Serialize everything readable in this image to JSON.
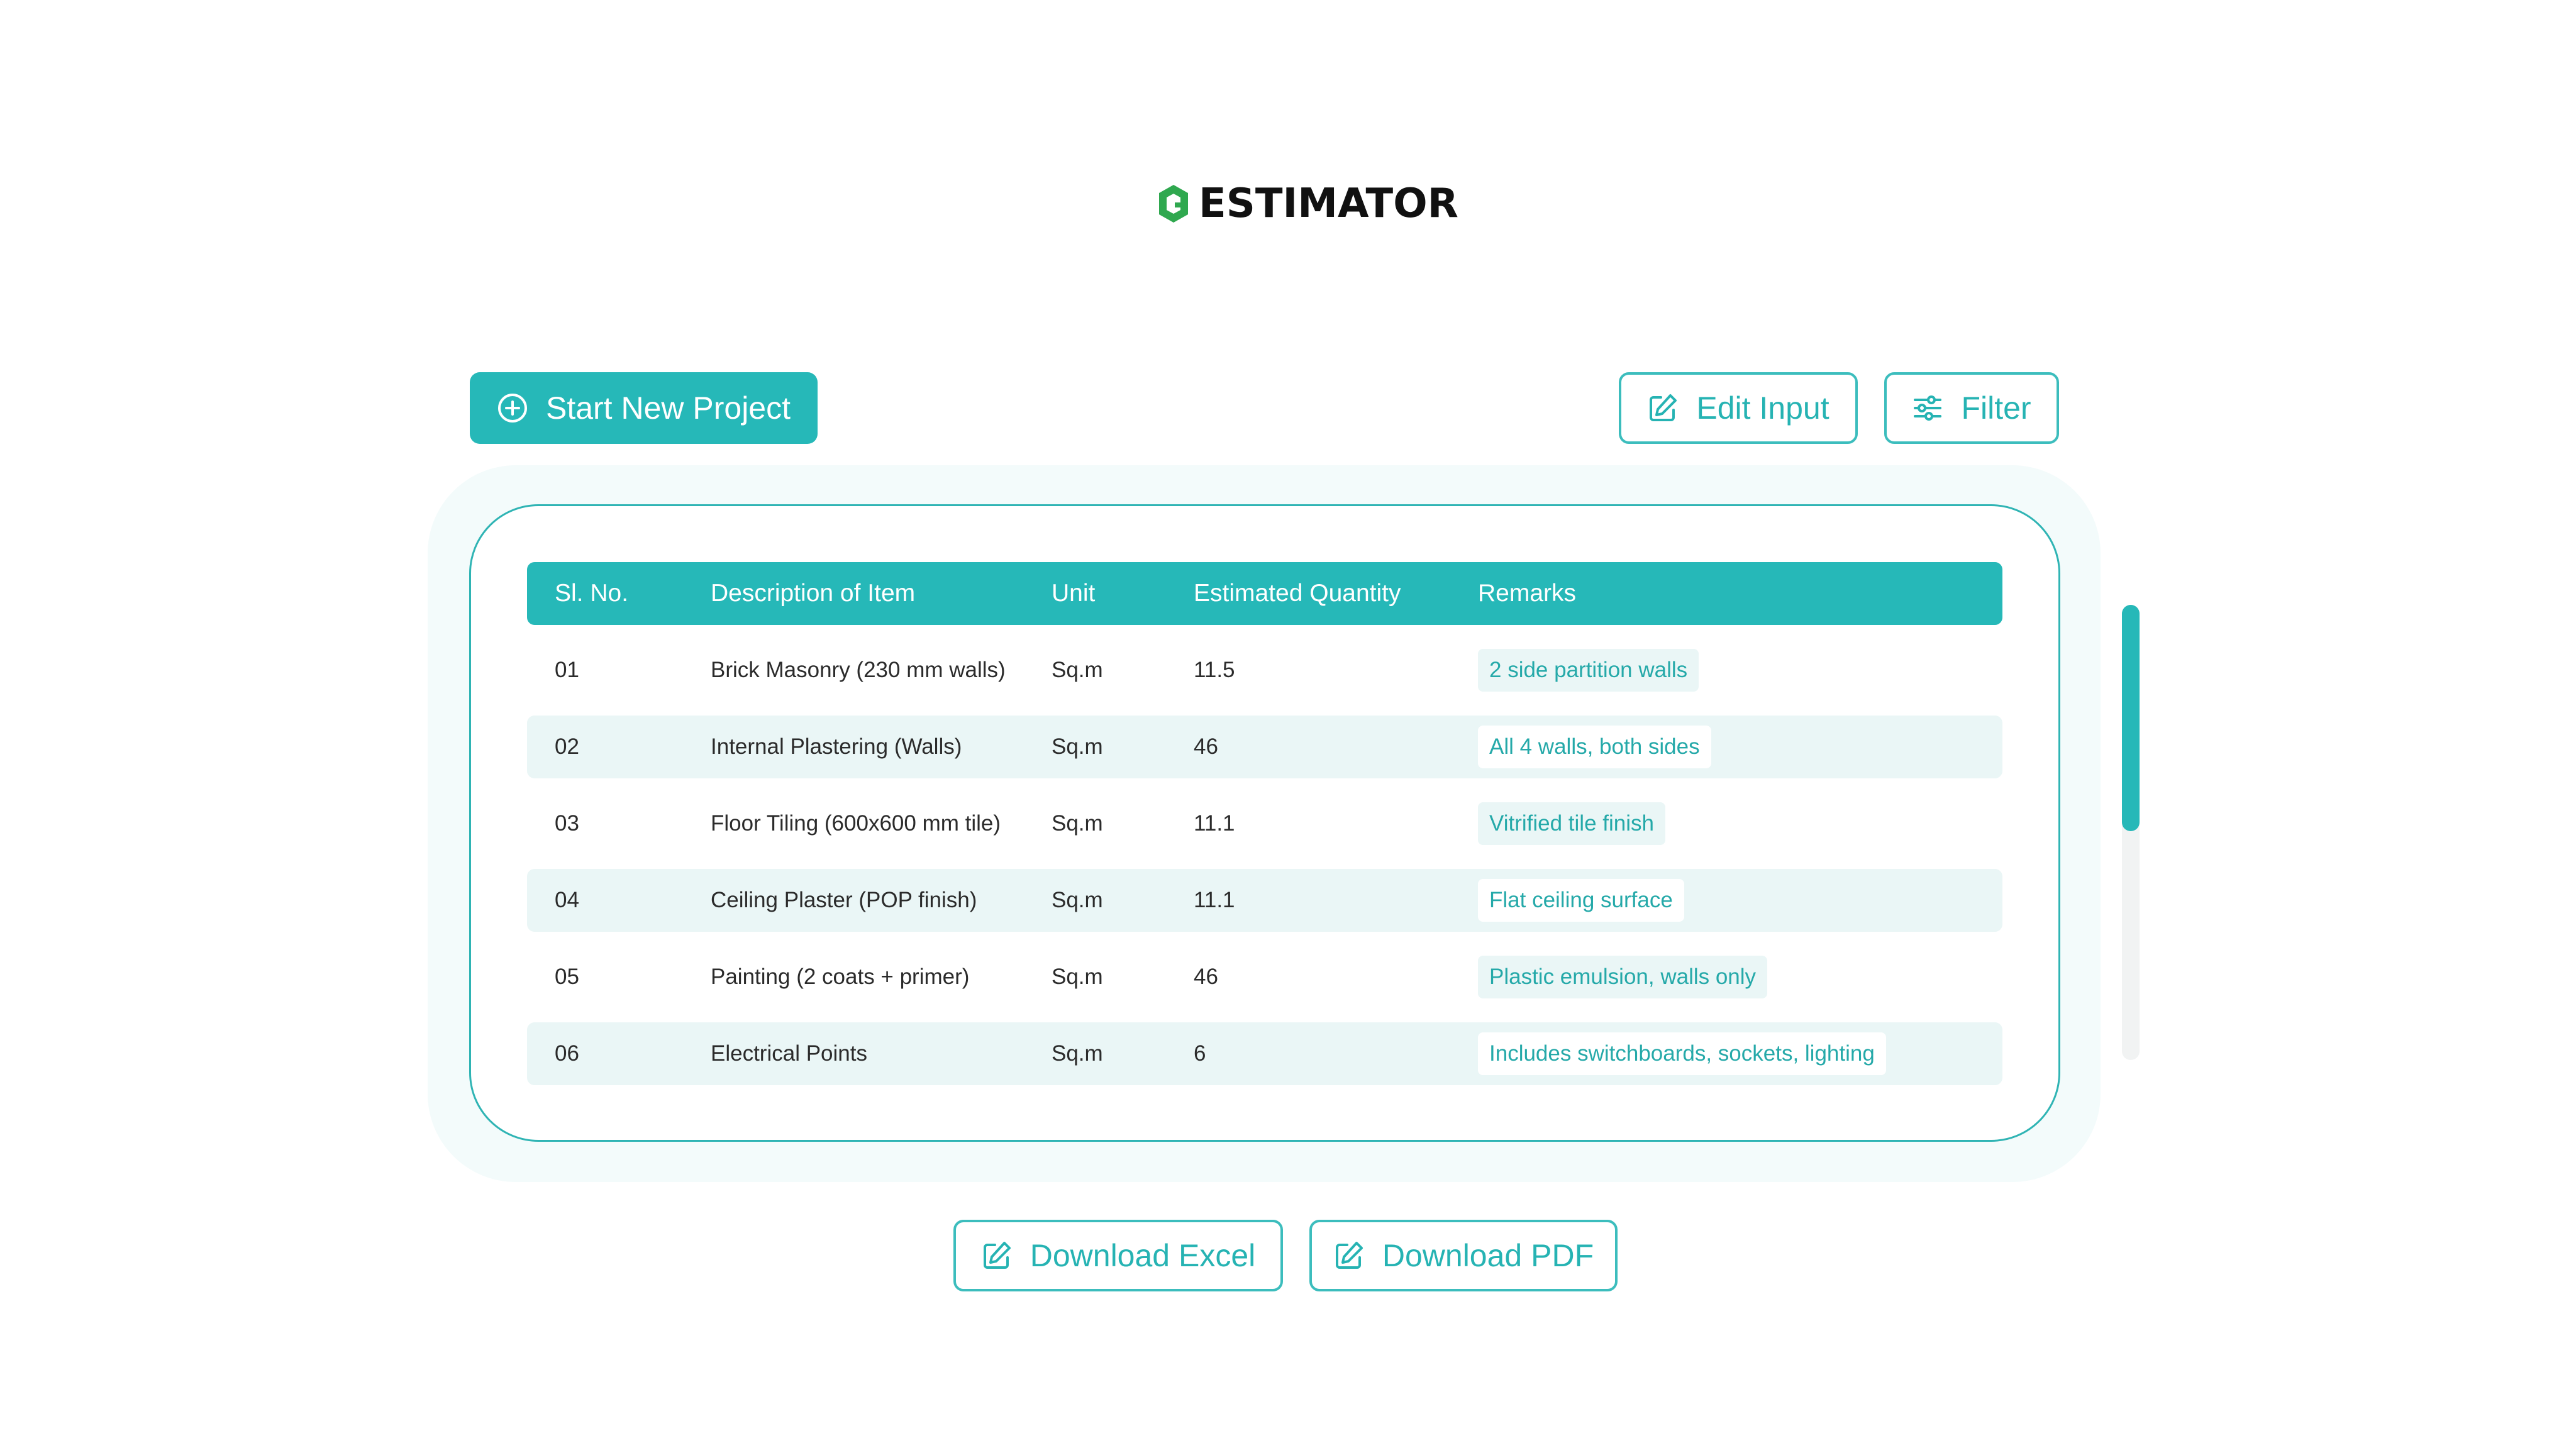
{
  "brand": {
    "name": "ESTIMATOR",
    "accent_color": "#2fa84f",
    "primary_color": "#26b8b8"
  },
  "toolbar": {
    "start_new_project_label": "Start New Project",
    "edit_input_label": "Edit Input",
    "filter_label": "Filter"
  },
  "table": {
    "columns": {
      "no": "Sl. No.",
      "description": "Description of Item",
      "unit": "Unit",
      "quantity": "Estimated Quantity",
      "remarks": "Remarks"
    },
    "rows": [
      {
        "no": "01",
        "description": "Brick Masonry (230 mm walls)",
        "unit": "Sq.m",
        "quantity": "11.5",
        "remarks": "2 side partition walls"
      },
      {
        "no": "02",
        "description": "Internal Plastering (Walls)",
        "unit": "Sq.m",
        "quantity": "46",
        "remarks": "All 4 walls, both sides"
      },
      {
        "no": "03",
        "description": "Floor Tiling (600x600 mm tile)",
        "unit": "Sq.m",
        "quantity": "11.1",
        "remarks": "Vitrified tile finish"
      },
      {
        "no": "04",
        "description": "Ceiling Plaster (POP finish)",
        "unit": "Sq.m",
        "quantity": "11.1",
        "remarks": "Flat ceiling surface"
      },
      {
        "no": "05",
        "description": "Painting (2 coats + primer)",
        "unit": "Sq.m",
        "quantity": "46",
        "remarks": "Plastic emulsion, walls only"
      },
      {
        "no": "06",
        "description": "Electrical Points",
        "unit": "Sq.m",
        "quantity": "6",
        "remarks": "Includes switchboards, sockets, lighting"
      }
    ]
  },
  "footer": {
    "download_excel_label": "Download Excel",
    "download_pdf_label": "Download PDF"
  },
  "icons": {
    "logo": "estimator-logo-icon",
    "start": "plus-circle-icon",
    "edit": "edit-icon",
    "filter": "sliders-icon",
    "excel": "edit-icon",
    "pdf": "edit-icon"
  }
}
